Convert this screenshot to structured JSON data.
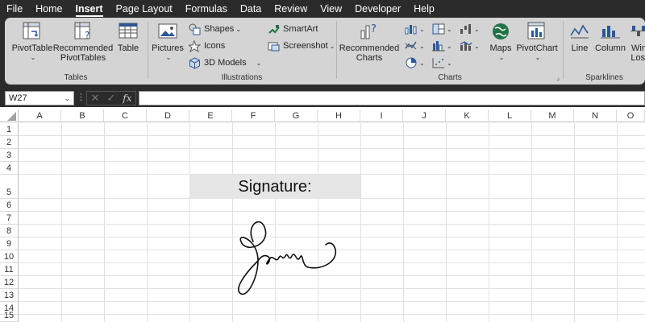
{
  "menu": {
    "items": [
      "File",
      "Home",
      "Insert",
      "Page Layout",
      "Formulas",
      "Data",
      "Review",
      "View",
      "Developer",
      "Help"
    ],
    "active": "Insert"
  },
  "ribbon": {
    "tables": {
      "label": "Tables",
      "pivot_table": "PivotTable",
      "recommended_pivot_1": "Recommended",
      "recommended_pivot_2": "PivotTables",
      "table": "Table"
    },
    "illustrations": {
      "label": "Illustrations",
      "pictures": "Pictures",
      "shapes": "Shapes",
      "icons": "Icons",
      "models_3d": "3D Models",
      "smartart": "SmartArt",
      "screenshot": "Screenshot"
    },
    "charts": {
      "label": "Charts",
      "recommended_1": "Recommended",
      "recommended_2": "Charts",
      "maps": "Maps",
      "pivotchart": "PivotChart"
    },
    "sparklines": {
      "label": "Sparklines",
      "line": "Line",
      "column": "Column",
      "winloss_1": "Win/",
      "winloss_2": "Loss"
    }
  },
  "formula_bar": {
    "name_box": "W27",
    "fx": "fx",
    "value": ""
  },
  "sheet": {
    "columns": [
      "A",
      "B",
      "C",
      "D",
      "E",
      "F",
      "G",
      "H",
      "I",
      "J",
      "K",
      "L",
      "M",
      "N",
      "O"
    ],
    "rows": [
      "1",
      "2",
      "3",
      "4",
      "5",
      "6",
      "7",
      "8",
      "9",
      "10",
      "11",
      "12",
      "13",
      "14",
      "15"
    ],
    "cell_e5": "Signature:"
  },
  "colors": {
    "dark_chrome": "#2b2b2b",
    "ribbon_bg": "#d4d4d4",
    "accent_green": "#217346",
    "icon_blue": "#2b579a"
  }
}
